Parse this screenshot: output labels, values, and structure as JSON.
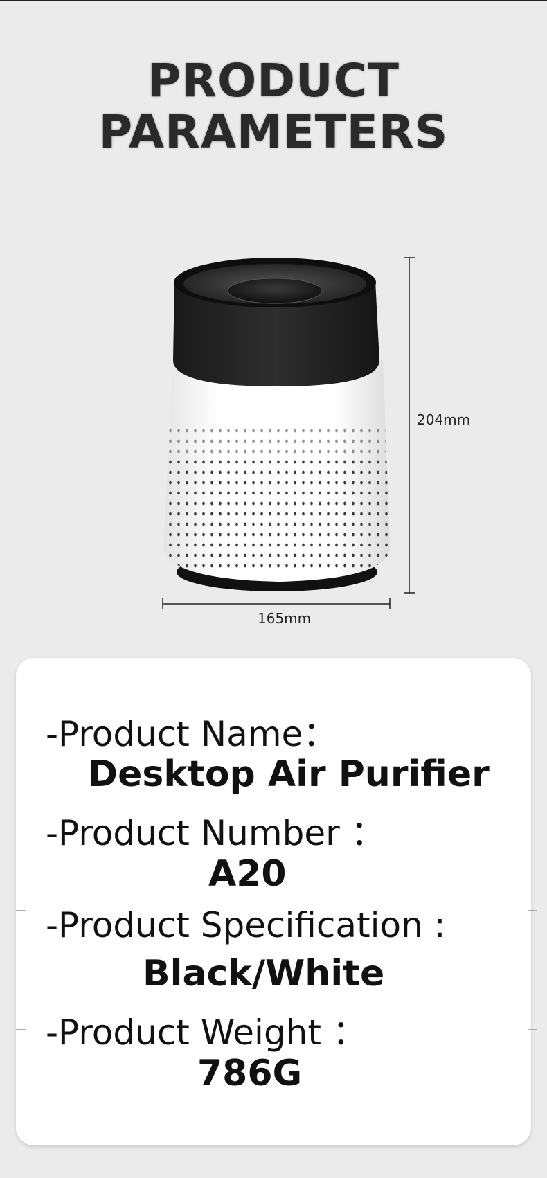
{
  "heading": {
    "line1": "PRODUCT",
    "line2": "PARAMETERS"
  },
  "dimensions": {
    "height": "204mm",
    "width": "165mm"
  },
  "params": [
    {
      "label": "-Product Name：",
      "value": "Desktop Air Purifier"
    },
    {
      "label": "-Product Number ：",
      "value": "A20"
    },
    {
      "label": "-Product Specification :",
      "value": "Black/White"
    },
    {
      "label": "-Product Weight ：",
      "value": "786G"
    }
  ],
  "colors": {
    "background": "#ebebeb",
    "card": "#ffffff",
    "text": "#111111"
  }
}
